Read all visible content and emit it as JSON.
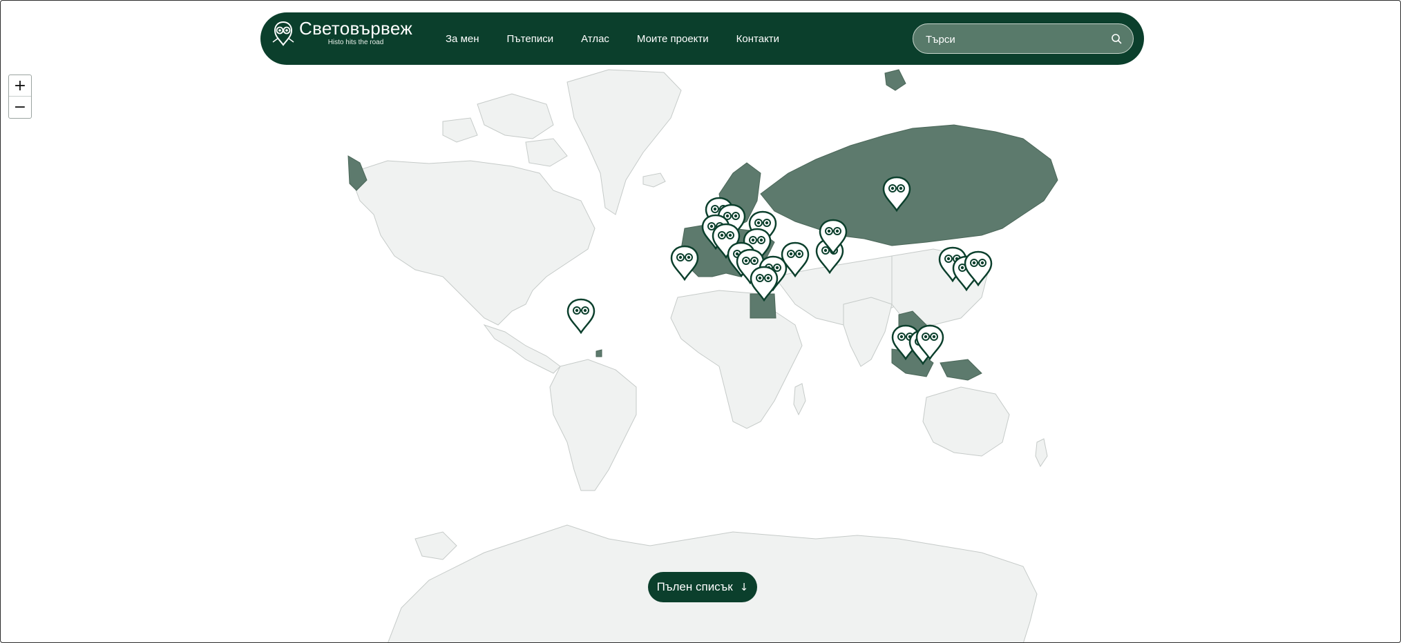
{
  "header": {
    "brand_title": "Световървеж",
    "brand_tagline": "Histo hits the road",
    "nav_items": [
      {
        "label": "За мен"
      },
      {
        "label": "Пътеписи"
      },
      {
        "label": "Атлас"
      },
      {
        "label": "Моите проекти"
      },
      {
        "label": "Контакти"
      }
    ],
    "search_placeholder": "Търси",
    "search_icon": "search-icon"
  },
  "map_controls": {
    "zoom_in": "+",
    "zoom_out": "−"
  },
  "map": {
    "visited_color": "#5d7a6d",
    "land_color": "#f0f2f1",
    "border_color": "#c5cac8",
    "marker_icon": "owl-pin-icon",
    "visited_regions": [
      "Russia",
      "Europe",
      "Egypt",
      "South-East Asia",
      "Japan",
      "Alaska"
    ]
  },
  "full_list_button": {
    "label": "Пълен списък",
    "icon": "arrow-down-icon"
  },
  "colors": {
    "brand_dark": "#0b3f2c"
  }
}
